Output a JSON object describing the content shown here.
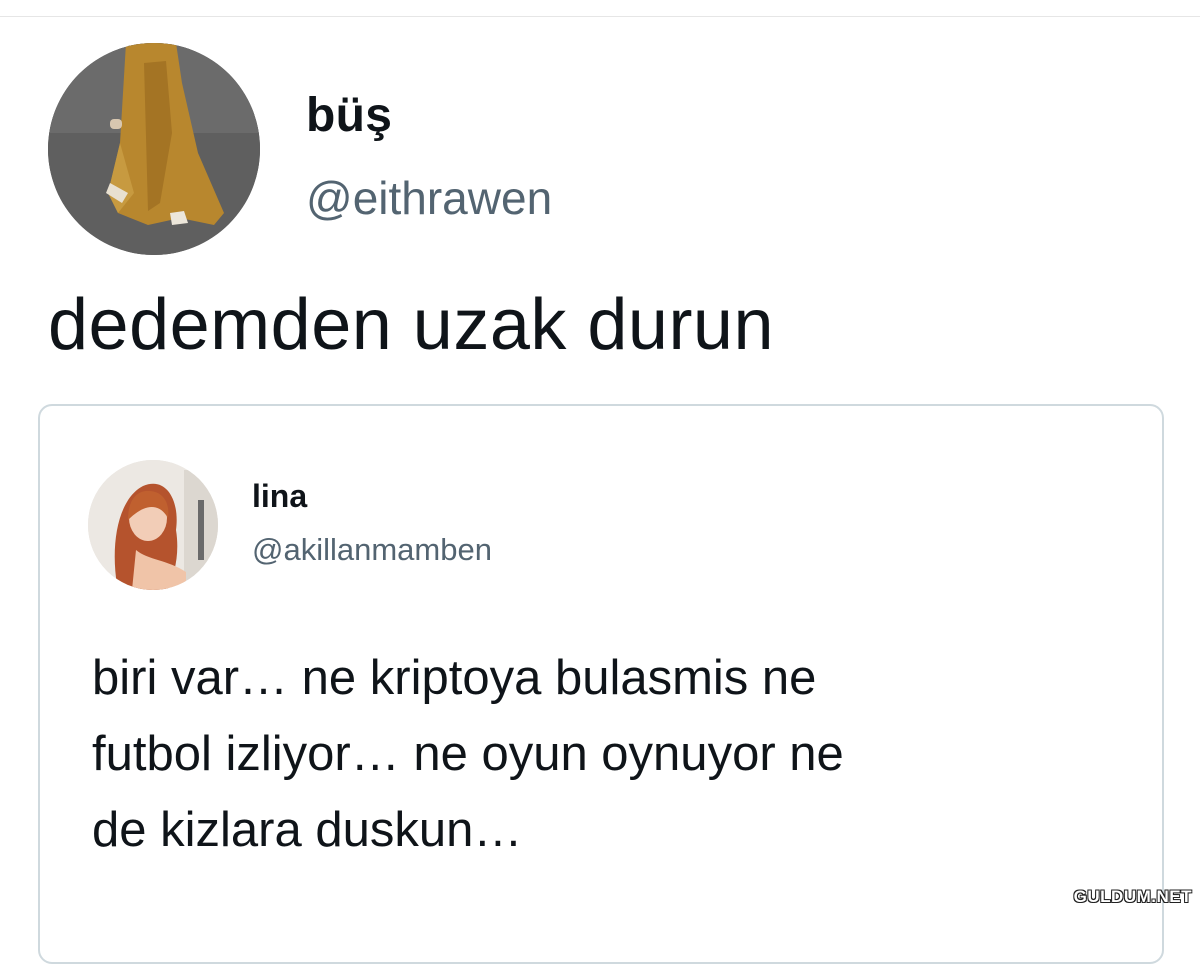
{
  "tweet": {
    "name": "büş",
    "handle": "@eithrawen",
    "text": "dedemden uzak durun",
    "avatar": "avatar-photo-person-in-yellow-coat"
  },
  "quoted_tweet": {
    "name": "lina",
    "handle": "@akillanmamben",
    "text_lines": [
      "biri var… ne kriptoya bulasmis ne",
      "futbol izliyor… ne oyun oynuyor ne",
      "de kizlara duskun…"
    ],
    "avatar": "avatar-photo-red-haired-woman"
  },
  "watermark": "GULDUM.NET",
  "colors": {
    "text": "#0f1419",
    "secondary_text": "#536471",
    "card_border": "#cfd9de"
  }
}
